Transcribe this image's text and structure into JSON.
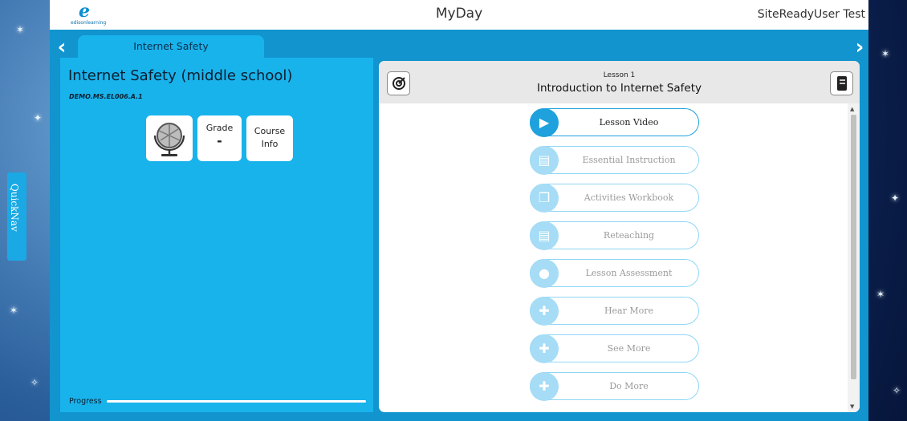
{
  "header": {
    "logo_text": "edisonlearning",
    "app_title": "MyDay",
    "user_name": "SiteReadyUser Test"
  },
  "nav": {
    "prev_arrow": "‹",
    "next_arrow": "›"
  },
  "tab": {
    "label": "Internet Safety"
  },
  "course": {
    "title": "Internet Safety (middle school)",
    "code": "DEMO.MS.EL006.A.1",
    "tiles": {
      "globe_icon": "globe-icon",
      "grade_label": "Grade",
      "grade_value": "-",
      "info_line1": "Course",
      "info_line2": "Info"
    },
    "progress_label": "Progress",
    "progress_fraction": 0.0
  },
  "quicknav": {
    "label": "QuickNav"
  },
  "lesson": {
    "number": "Lesson 1",
    "title": "Introduction to Internet Safety",
    "target_icon": "target-icon",
    "notebook_icon": "notebook-icon",
    "activities": [
      {
        "label": "Lesson Video",
        "icon": "video-icon",
        "active": true
      },
      {
        "label": "Essential Instruction",
        "icon": "book-icon",
        "active": false
      },
      {
        "label": "Activities Workbook",
        "icon": "pages-icon",
        "active": false
      },
      {
        "label": "Reteaching",
        "icon": "book-icon",
        "active": false
      },
      {
        "label": "Lesson Assessment",
        "icon": "apple-icon",
        "active": false
      },
      {
        "label": "Hear More",
        "icon": "puzzle-icon",
        "active": false
      },
      {
        "label": "See More",
        "icon": "puzzle-icon",
        "active": false
      },
      {
        "label": "Do More",
        "icon": "puzzle-icon",
        "active": false
      }
    ]
  },
  "colors": {
    "frame": "#1294cf",
    "panel": "#19b3ec",
    "active_accent": "#1ea1dc",
    "inactive_accent": "#a6dcf5"
  }
}
